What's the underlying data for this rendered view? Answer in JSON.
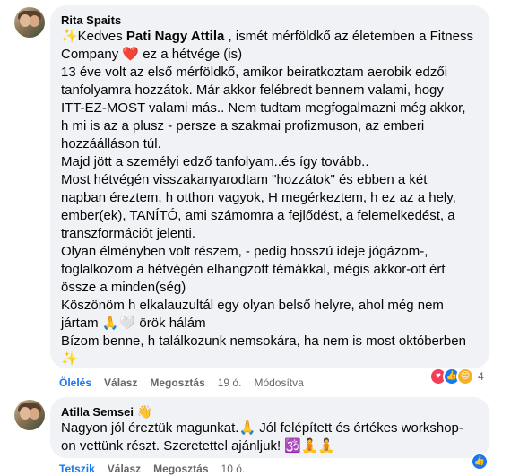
{
  "comments": [
    {
      "author": "Rita Spaits",
      "line0_prefix": "✨Kedves ",
      "mention": "Pati Nagy Attila",
      "line0_suffix": " , ismét mérföldkő az életemben a Fitness",
      "body_lines": [
        "Company ❤️ ez a hétvége (is)",
        "13 éve volt az első mérföldkő, amikor beiratkoztam aerobik edzői",
        "tanfolyamra hozzátok. Már akkor felébredt bennem valami, hogy",
        "ITT-EZ-MOST valami más.. Nem tudtam megfogalmazni még akkor,",
        "h mi is az a plusz - persze a szakmai profizmuson, az emberi",
        "hozzáálláson túl.",
        "Majd jött a személyi edző tanfolyam..és így tovább..",
        "Most hétvégén visszakanyarodtam \"hozzátok\" és ebben a két",
        "napban éreztem, h otthon vagyok, H megérkeztem, h ez az a hely,",
        "ember(ek), TANÍTÓ, ami számomra a fejlődést, a felemelkedést, a",
        "transzformációt jelenti.",
        "Olyan élményben volt részem, - pedig hosszú ideje jógázom-,",
        "foglalkozom a hétvégén elhangzott témákkal, mégis akkor-ott ért",
        "össze a minden(ség)",
        "Köszönöm h elkalauzultál egy olyan belső helyre, ahol még nem",
        "jártam 🙏🤍 örök hálám",
        "Bízom benne, h találkozunk nemsokára, ha nem is most októberben",
        "✨"
      ],
      "actions": {
        "like": "Ölelés",
        "reply": "Válasz",
        "share": "Megosztás",
        "time": "19 ó.",
        "edited": "Módosítva"
      },
      "reactions": {
        "icons": [
          "love-reaction-icon",
          "like-reaction-icon",
          "care-reaction-icon"
        ],
        "count": "4"
      }
    },
    {
      "author": "Atilla Semsei",
      "author_badge": "waving-hand-icon",
      "body_lines": [
        "Nagyon jól éreztük magunkat.🙏 Jól felépített és értékes workshop-",
        "on vettünk részt. Szeretettel ajánljuk! 🕉️🧘🧘"
      ],
      "actions": {
        "like": "Tetszik",
        "reply": "Válasz",
        "share": "Megosztás",
        "time": "10 ó."
      },
      "reactions": {
        "icons": [
          "like-reaction-icon"
        ]
      }
    }
  ],
  "colors": {
    "bubble": "#f0f2f5",
    "meta_text": "#65676b",
    "liked_blue": "#1877f2",
    "love_red": "#f33e58",
    "care_yellow": "#f7b125"
  }
}
